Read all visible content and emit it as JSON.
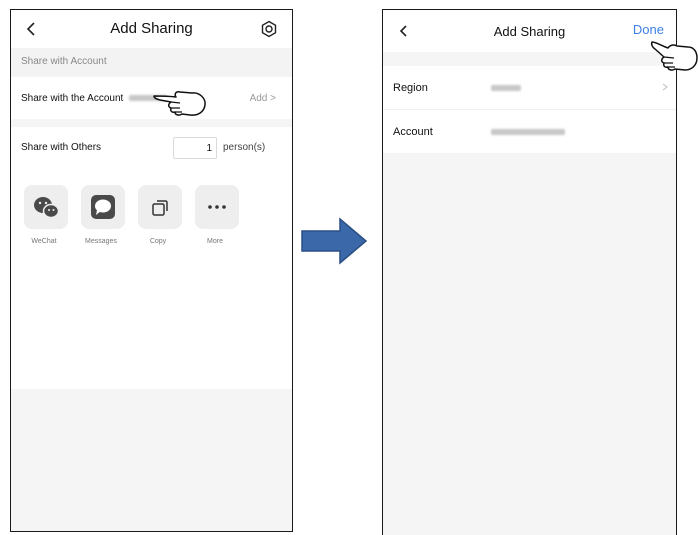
{
  "left_screen": {
    "title": "Add Sharing",
    "section_header": "Share with Account",
    "share_account_row": {
      "label": "Share with the Account",
      "action": "Add >"
    },
    "share_others_row": {
      "label": "Share with Others",
      "count": "1",
      "unit": "person(s)"
    },
    "share_options": [
      {
        "label": "WeChat",
        "icon": "wechat-icon"
      },
      {
        "label": "Messages",
        "icon": "messages-icon"
      },
      {
        "label": "Copy",
        "icon": "copy-icon"
      },
      {
        "label": "More",
        "icon": "more-icon"
      }
    ]
  },
  "right_screen": {
    "title": "Add Sharing",
    "done_label": "Done",
    "rows": [
      {
        "label": "Region"
      },
      {
        "label": "Account"
      }
    ]
  },
  "colors": {
    "accent": "#3f7fe6",
    "arrow": "#3b68a8",
    "background": "#f5f5f5"
  }
}
